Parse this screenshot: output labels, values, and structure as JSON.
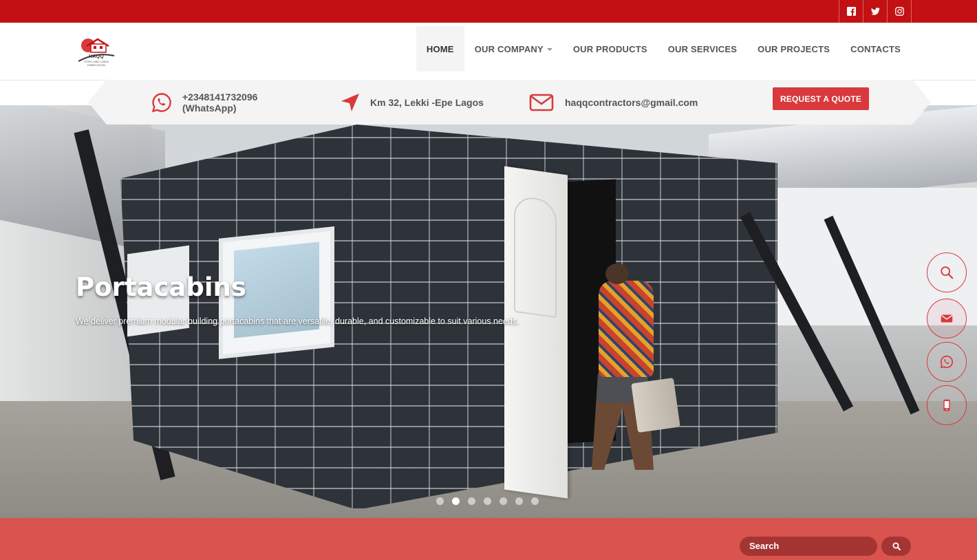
{
  "topbar": {
    "social_icons": [
      "facebook-icon",
      "twitter-icon",
      "instagram-icon"
    ],
    "color": "#c31113"
  },
  "logo": {
    "text": "HAQQ",
    "subtitle": "STEEL AND CABIN FABRICATION"
  },
  "nav": {
    "items": [
      {
        "label": "HOME",
        "active": true
      },
      {
        "label": "OUR COMPANY",
        "has_dropdown": true
      },
      {
        "label": "OUR PRODUCTS"
      },
      {
        "label": "OUR SERVICES"
      },
      {
        "label": "OUR PROJECTS"
      },
      {
        "label": "CONTACTS"
      }
    ]
  },
  "contact": {
    "phone_line1": "+2348141732096",
    "phone_line2": "(WhatsApp)",
    "address": "Km 32, Lekki -Epe Lagos",
    "email": "haqqcontractors@gmail.com",
    "quote_label": "REQUEST A QUOTE"
  },
  "hero": {
    "title": "Portacabins",
    "description": "We deliver premium modular building portacabins that are versatile, durable, and customizable to suit various needs.",
    "slide_count": 7,
    "active_slide": 2
  },
  "side_buttons": [
    "search-icon",
    "envelope-icon",
    "whatsapp-icon",
    "mobile-phone-icon"
  ],
  "footer_bar": {
    "search_placeholder": "Search",
    "color": "#d9534f"
  },
  "colors": {
    "accent": "#d9393c",
    "topbar": "#c31113"
  }
}
